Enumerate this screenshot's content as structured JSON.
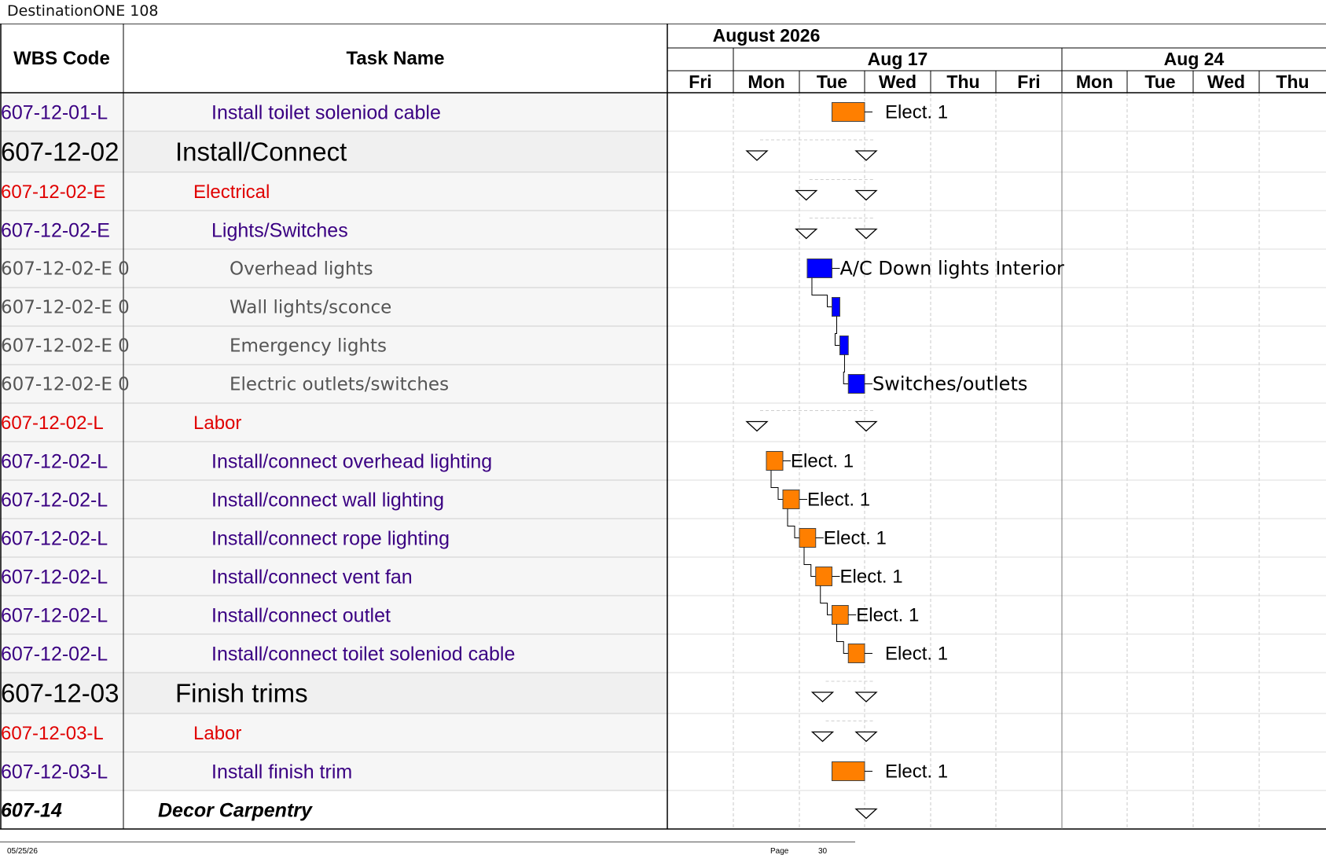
{
  "app_title": "DestinationONE 108",
  "header": {
    "wbs_label": "WBS Code",
    "task_label": "Task Name",
    "month_label": "August 2026",
    "weeks": [
      "Aug 17",
      "Aug 24"
    ],
    "days": [
      "Fri",
      "Mon",
      "Tue",
      "Wed",
      "Thu",
      "Fri",
      "Mon",
      "Tue",
      "Wed",
      "Thu"
    ]
  },
  "colors": {
    "labor_bar": "#ff7f00",
    "electrical_bar": "#0000ff",
    "wbs_leaf": "#3a0082",
    "wbs_category": "#e00000",
    "wbs_group": "#000000",
    "wbs_detail": "#555555"
  },
  "rows": [
    {
      "wbs": "607-12-01-L",
      "task": "Install toilet soleniod cable",
      "style": "leaf",
      "indent": 3,
      "gantt": {
        "kind": "bar",
        "color": "orange",
        "start": 2.5,
        "end": 3.0,
        "label": "Elect. 1"
      }
    },
    {
      "wbs": "607-12-02",
      "task": "Install/Connect",
      "style": "group",
      "indent": 1,
      "gantt": {
        "kind": "summary",
        "start": 1.5,
        "end": 3.0
      }
    },
    {
      "wbs": "607-12-02-E",
      "task": "Electrical",
      "style": "category",
      "indent": 2,
      "gantt": {
        "kind": "summary",
        "start": 2.25,
        "end": 3.0
      }
    },
    {
      "wbs": "607-12-02-E",
      "task": "Lights/Switches",
      "style": "leaf",
      "indent": 3,
      "gantt": {
        "kind": "summary",
        "start": 2.25,
        "end": 3.0
      }
    },
    {
      "wbs": "607-12-02-E 0",
      "task": "Overhead lights",
      "style": "detail",
      "indent": 4,
      "gantt": {
        "kind": "bar",
        "color": "blue",
        "start": 2.12,
        "end": 2.5,
        "label": "A/C Down lights Interior"
      }
    },
    {
      "wbs": "607-12-02-E 0",
      "task": "Wall lights/sconce",
      "style": "detail",
      "indent": 4,
      "gantt": {
        "kind": "bar",
        "color": "blue",
        "start": 2.5,
        "end": 2.62,
        "label": ""
      }
    },
    {
      "wbs": "607-12-02-E 0",
      "task": "Emergency lights",
      "style": "detail",
      "indent": 4,
      "gantt": {
        "kind": "bar",
        "color": "blue",
        "start": 2.62,
        "end": 2.75,
        "label": ""
      }
    },
    {
      "wbs": "607-12-02-E 0",
      "task": "Electric outlets/switches",
      "style": "detail",
      "indent": 4,
      "gantt": {
        "kind": "bar",
        "color": "blue",
        "start": 2.75,
        "end": 3.0,
        "label": "Switches/outlets"
      }
    },
    {
      "wbs": "607-12-02-L",
      "task": "Labor",
      "style": "category",
      "indent": 2,
      "gantt": {
        "kind": "summary",
        "start": 1.5,
        "end": 3.0
      }
    },
    {
      "wbs": "607-12-02-L",
      "task": "Install/connect overhead lighting",
      "style": "leaf",
      "indent": 3,
      "gantt": {
        "kind": "bar",
        "color": "orange",
        "start": 1.5,
        "end": 1.75,
        "label": "Elect. 1"
      }
    },
    {
      "wbs": "607-12-02-L",
      "task": "Install/connect wall lighting",
      "style": "leaf",
      "indent": 3,
      "gantt": {
        "kind": "bar",
        "color": "orange",
        "start": 1.75,
        "end": 2.0,
        "label": "Elect. 1"
      }
    },
    {
      "wbs": "607-12-02-L",
      "task": "Install/connect rope lighting",
      "style": "leaf",
      "indent": 3,
      "gantt": {
        "kind": "bar",
        "color": "orange",
        "start": 2.0,
        "end": 2.25,
        "label": "Elect. 1"
      }
    },
    {
      "wbs": "607-12-02-L",
      "task": "Install/connect vent fan",
      "style": "leaf",
      "indent": 3,
      "gantt": {
        "kind": "bar",
        "color": "orange",
        "start": 2.25,
        "end": 2.5,
        "label": "Elect. 1"
      }
    },
    {
      "wbs": "607-12-02-L",
      "task": "Install/connect outlet",
      "style": "leaf",
      "indent": 3,
      "gantt": {
        "kind": "bar",
        "color": "orange",
        "start": 2.5,
        "end": 2.75,
        "label": "Elect. 1"
      }
    },
    {
      "wbs": "607-12-02-L",
      "task": "Install/connect toilet soleniod cable",
      "style": "leaf",
      "indent": 3,
      "gantt": {
        "kind": "bar",
        "color": "orange",
        "start": 2.75,
        "end": 3.0,
        "label": "Elect. 1"
      }
    },
    {
      "wbs": "607-12-03",
      "task": "Finish trims",
      "style": "group",
      "indent": 1,
      "gantt": {
        "kind": "summary",
        "start": 2.5,
        "end": 3.0
      }
    },
    {
      "wbs": "607-12-03-L",
      "task": "Labor",
      "style": "category",
      "indent": 2,
      "gantt": {
        "kind": "summary",
        "start": 2.5,
        "end": 3.0
      }
    },
    {
      "wbs": "607-12-03-L",
      "task": "Install finish trim",
      "style": "leaf",
      "indent": 3,
      "gantt": {
        "kind": "bar",
        "color": "orange",
        "start": 2.5,
        "end": 3.0,
        "label": "Elect. 1"
      }
    },
    {
      "wbs": "607-14",
      "task": "Decor Carpentry",
      "style": "top",
      "indent": 0,
      "gantt": {
        "kind": "summary",
        "start": 3.0,
        "end": 3.0
      }
    }
  ],
  "footer": {
    "date": "05/25/26",
    "page_label": "Page",
    "page_number": "30"
  }
}
